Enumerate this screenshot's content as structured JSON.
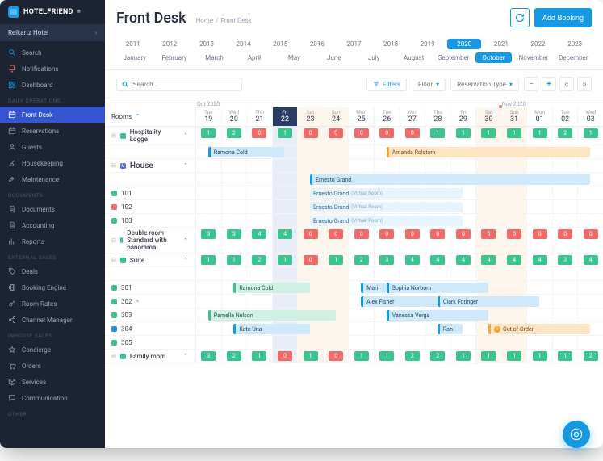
{
  "brand": "HOTELFRIEND",
  "hotel": "Reikartz Hotel",
  "sidebar": {
    "top": [
      {
        "label": "Search",
        "icon": "search",
        "color": "#1698e3"
      },
      {
        "label": "Notifications",
        "icon": "bell",
        "color": "#f16a6a"
      },
      {
        "label": "Dashboard",
        "icon": "grid",
        "color": "#1698e3"
      }
    ],
    "groups": [
      {
        "title": "Daily Operations",
        "items": [
          {
            "label": "Front Desk",
            "icon": "calendar",
            "active": true
          },
          {
            "label": "Reservations",
            "icon": "calendar"
          },
          {
            "label": "Guests",
            "icon": "user"
          },
          {
            "label": "Housekeeping",
            "icon": "broom"
          },
          {
            "label": "Maintenance",
            "icon": "wrench"
          }
        ]
      },
      {
        "title": "Documents",
        "items": [
          {
            "label": "Documents",
            "icon": "doc"
          },
          {
            "label": "Accounting",
            "icon": "doc"
          },
          {
            "label": "Reports",
            "icon": "chart"
          }
        ]
      },
      {
        "title": "External Sales",
        "items": [
          {
            "label": "Deals",
            "icon": "tag"
          },
          {
            "label": "Booking Engine",
            "icon": "globe"
          },
          {
            "label": "Room Rates",
            "icon": "key"
          },
          {
            "label": "Channel Manager",
            "icon": "share"
          }
        ]
      },
      {
        "title": "Inhouse Sales",
        "items": [
          {
            "label": "Concierge",
            "icon": "star"
          },
          {
            "label": "Orders",
            "icon": "cart"
          },
          {
            "label": "Services",
            "icon": "box"
          },
          {
            "label": "Communication",
            "icon": "chat"
          }
        ]
      },
      {
        "title": "Other",
        "items": []
      }
    ]
  },
  "header": {
    "title": "Front Desk",
    "crumbs": [
      "Home",
      "Front Desk"
    ],
    "addBtn": "Add Booking"
  },
  "years": [
    "2011",
    "2012",
    "2013",
    "2014",
    "2015",
    "2016",
    "2017",
    "2018",
    "2019",
    "2020",
    "2021",
    "2022",
    "2023"
  ],
  "yearSel": "2020",
  "months": [
    "January",
    "February",
    "March",
    "April",
    "May",
    "June",
    "July",
    "August",
    "September",
    "October",
    "November",
    "December"
  ],
  "monthSel": "October",
  "filters": {
    "searchPlaceholder": "Search...",
    "filtersBtn": "Filters",
    "floor": "Floor",
    "resType": "Reservation Type"
  },
  "monthLabels": [
    "Oct 2020",
    "Nov 2020"
  ],
  "dateHeader": {
    "roomsLabel": "Rooms",
    "days": [
      {
        "dow": "Tue",
        "num": "19"
      },
      {
        "dow": "Wed",
        "num": "20"
      },
      {
        "dow": "Thu",
        "num": "21"
      },
      {
        "dow": "Fri",
        "num": "22",
        "today": true
      },
      {
        "dow": "Sat",
        "num": "23",
        "wknd": true
      },
      {
        "dow": "Sun",
        "num": "24",
        "wknd": true
      },
      {
        "dow": "Mon",
        "num": "25"
      },
      {
        "dow": "Tue",
        "num": "26"
      },
      {
        "dow": "Wed",
        "num": "27"
      },
      {
        "dow": "Thu",
        "num": "28"
      },
      {
        "dow": "Fri",
        "num": "29"
      },
      {
        "dow": "Sat",
        "num": "30",
        "wknd": true,
        "dot": true
      },
      {
        "dow": "Sun",
        "num": "31",
        "wknd": true
      },
      {
        "dow": "Mon",
        "num": "01"
      },
      {
        "dow": "Tue",
        "num": "02"
      },
      {
        "dow": "Wed",
        "num": "03"
      }
    ]
  },
  "rows": [
    {
      "type": "cat",
      "label": "Hospitality Logge",
      "collapse": true,
      "color": "#3bc48f",
      "avail": [
        "1g",
        "2g",
        "0r",
        "1g",
        "0r",
        "0r",
        "0r",
        "0r",
        "0r",
        "1g",
        "1g",
        "1g",
        "1g",
        "1g",
        "2g",
        "1g"
      ]
    },
    {
      "type": "room",
      "label": "",
      "bookings": [
        {
          "start": 1,
          "span": 3,
          "cls": "b-blue",
          "label": "Ramona Cold",
          "dashpre": true
        },
        {
          "start": 8,
          "span": 8,
          "cls": "b-orange",
          "label": "Amanda Rolstom"
        }
      ]
    },
    {
      "type": "cat",
      "label": "House",
      "collapse": true,
      "badge": "V",
      "badgeColor": "#4a6af0",
      "avail": []
    },
    {
      "type": "room",
      "label": "",
      "bookings": [
        {
          "start": 5,
          "span": 11,
          "cls": "b-blue",
          "label": "Ernesto Grand"
        }
      ]
    },
    {
      "type": "room",
      "label": "101",
      "color": "#3bc48f",
      "bookings": [
        {
          "start": 5,
          "span": 6,
          "cls": "b-lblue",
          "label": "Ernesto Grand",
          "note": "(Virtual Room)"
        }
      ]
    },
    {
      "type": "room",
      "label": "102",
      "color": "#f16a6a",
      "bookings": [
        {
          "start": 5,
          "span": 6,
          "cls": "b-lblue",
          "label": "Ernesto Grand",
          "note": "(Virtual Room)"
        }
      ]
    },
    {
      "type": "room",
      "label": "103",
      "color": "#3bc48f",
      "bookings": [
        {
          "start": 5,
          "span": 6,
          "cls": "b-lblue",
          "label": "Ernesto Grand",
          "note": "(Virtual Room)"
        }
      ]
    },
    {
      "type": "cat",
      "label": "Double room Standard with panorama",
      "collapse": true,
      "color": "#3bc48f",
      "tall": true,
      "avail": [
        "3g",
        "3g",
        "4g",
        "4g",
        "0r",
        "0r",
        "0r",
        "0r",
        "0r",
        "0r",
        "0r",
        "0r",
        "0r",
        "0r",
        "0r",
        "0r"
      ]
    },
    {
      "type": "cat",
      "label": "Suite",
      "collapse": true,
      "color": "#3bc48f",
      "avail": [
        "1g",
        "1g",
        "2g",
        "1g",
        "0r",
        "1g",
        "2g",
        "3g",
        "4g",
        "4g",
        "4g",
        "4g",
        "4g",
        "4g",
        "3g",
        "4g"
      ]
    },
    {
      "type": "room",
      "label": "",
      "bookings": []
    },
    {
      "type": "room",
      "label": "301",
      "color": "#3bc48f",
      "bookings": [
        {
          "start": 2,
          "span": 3,
          "cls": "b-green",
          "label": "Ramona Cold",
          "dashpre": true
        },
        {
          "start": 7,
          "span": 1,
          "cls": "b-blue",
          "label": "Mari"
        },
        {
          "start": 8,
          "span": 4,
          "cls": "b-blue",
          "label": "Sophia Norbom"
        }
      ]
    },
    {
      "type": "room",
      "label": "302",
      "color": "#3bc48f",
      "note": "×",
      "bookings": [
        {
          "start": 7,
          "span": 3,
          "cls": "b-blue",
          "label": "Alex Fisher"
        },
        {
          "start": 10,
          "span": 4,
          "cls": "b-blue",
          "label": "Clark Fotinger"
        }
      ]
    },
    {
      "type": "room",
      "label": "303",
      "color": "#3bc48f",
      "bookings": [
        {
          "start": 1,
          "span": 5,
          "cls": "b-green",
          "label": "Pamella Nelson",
          "dashpre": true
        },
        {
          "start": 8,
          "span": 4,
          "cls": "b-blue",
          "label": "Vanessa Verga"
        }
      ]
    },
    {
      "type": "room",
      "label": "304",
      "color": "#1698e3",
      "bookings": [
        {
          "start": 2,
          "span": 3,
          "cls": "b-blue",
          "label": "Kate Una"
        },
        {
          "start": 10,
          "span": 1,
          "cls": "b-blue",
          "label": "Ron"
        },
        {
          "start": 12,
          "span": 4,
          "cls": "b-orange",
          "label": "Out of Order",
          "oo": true
        }
      ]
    },
    {
      "type": "room",
      "label": "305",
      "color": "#3bc48f",
      "bookings": []
    },
    {
      "type": "cat",
      "label": "Family room",
      "collapse": true,
      "color": "#3bc48f",
      "avail": [
        "3g",
        "2g",
        "1g",
        "0r",
        "1g",
        "0r",
        "1g",
        "1g",
        "2g",
        "2g",
        "1g",
        "1g",
        "1g",
        "1g",
        "1g",
        "2g"
      ]
    }
  ]
}
